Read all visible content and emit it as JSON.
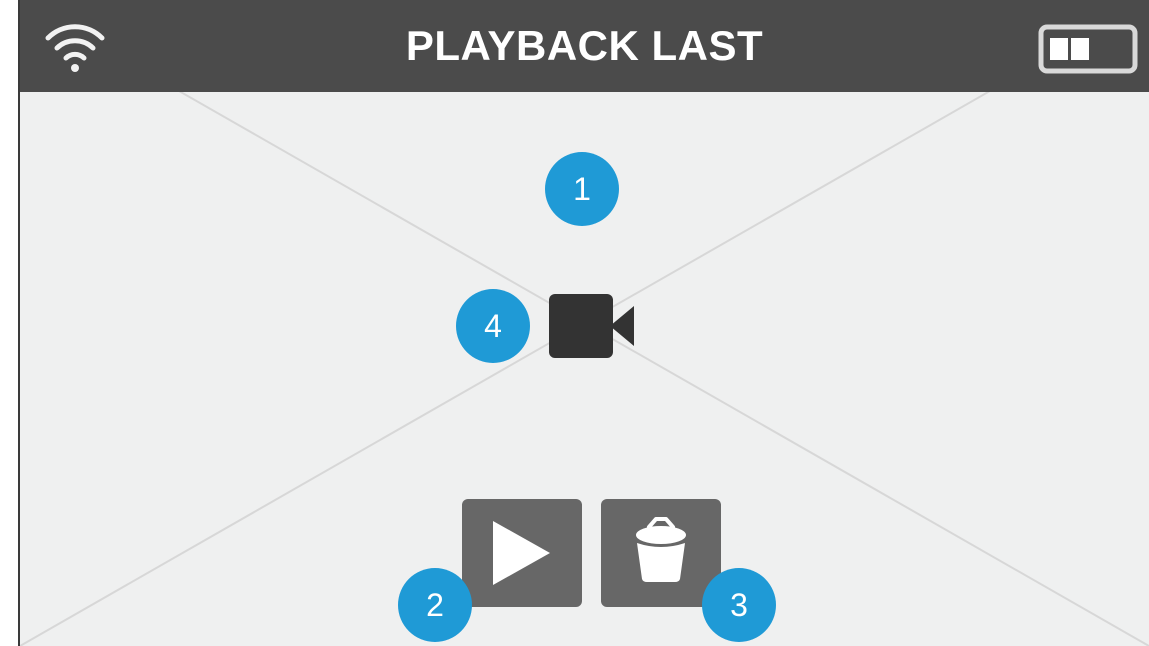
{
  "header": {
    "title": "PLAYBACK LAST",
    "wifi_icon": "wifi-icon",
    "battery_icon": "battery-icon"
  },
  "main": {
    "center_icon": "video-camera-icon"
  },
  "controls": {
    "play_icon": "play-icon",
    "delete_icon": "trash-icon"
  },
  "annotations": {
    "badge_1": "1",
    "badge_2": "2",
    "badge_3": "3",
    "badge_4": "4"
  },
  "colors": {
    "header_bg": "#4b4b4b",
    "screen_bg": "#eff0f0",
    "badge_bg": "#1f9ad6",
    "button_bg": "#676767",
    "icon_dark": "#333333"
  }
}
